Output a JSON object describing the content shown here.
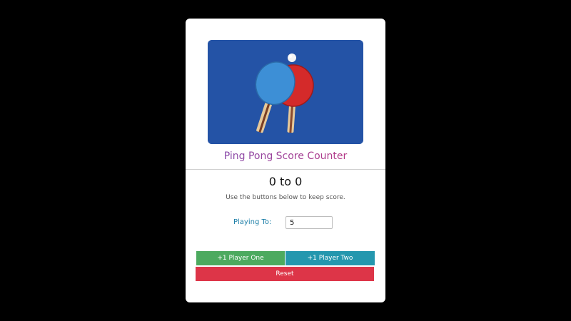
{
  "app": {
    "title": "Ping Pong Score Counter"
  },
  "score": {
    "player_one": 0,
    "player_two": 0,
    "separator": "to",
    "display": "0 to 0",
    "hint": "Use the buttons below to keep score."
  },
  "settings": {
    "playing_to_label": "Playing To:",
    "playing_to_value": "5"
  },
  "buttons": {
    "player_one": "+1 Player One",
    "player_two": "+1 Player Two",
    "reset": "Reset"
  },
  "image": {
    "subject": "two ping pong paddles with a ball on a blue background"
  },
  "colors": {
    "page_background": "#000000",
    "card_background": "#ffffff",
    "title_gradient_start": "#7a4fb4",
    "title_gradient_end": "#c2307a",
    "label_color": "#1d7fa8",
    "player_one_button": "#4caa5f",
    "player_two_button": "#2497ae",
    "reset_button": "#dd3548",
    "image_background": "#2453a6"
  }
}
